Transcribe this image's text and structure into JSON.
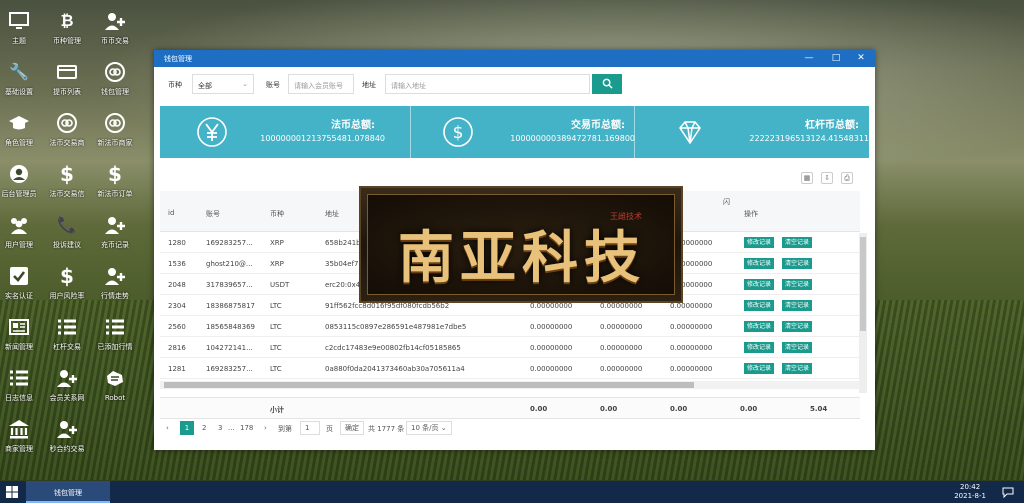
{
  "desktop": {
    "icons": [
      {
        "label": "主题",
        "icon": "monitor-icon"
      },
      {
        "label": "币种管理",
        "icon": "bitcoin-icon"
      },
      {
        "label": "币币交易",
        "icon": "user-plus-icon"
      },
      {
        "label": "基础设置",
        "icon": "wrench-icon"
      },
      {
        "label": "提币列表",
        "icon": "card-icon"
      },
      {
        "label": "钱包管理",
        "icon": "link-icon"
      },
      {
        "label": "角色管理",
        "icon": "graduation-icon"
      },
      {
        "label": "法币交易商",
        "icon": "link-icon"
      },
      {
        "label": "新法币商家",
        "icon": "link-icon"
      },
      {
        "label": "后台管理员",
        "icon": "user-circle-icon"
      },
      {
        "label": "法币交易信",
        "icon": "dollar-icon"
      },
      {
        "label": "新法币订单",
        "icon": "dollar-icon"
      },
      {
        "label": "用户管理",
        "icon": "users-icon"
      },
      {
        "label": "投诉建议",
        "icon": "phone-icon"
      },
      {
        "label": "充币记录",
        "icon": "user-plus-icon"
      },
      {
        "label": "实名认证",
        "icon": "check-icon"
      },
      {
        "label": "用户风险率",
        "icon": "dollar-icon"
      },
      {
        "label": "行情走势",
        "icon": "user-plus-icon"
      },
      {
        "label": "新闻管理",
        "icon": "news-icon"
      },
      {
        "label": "杠杆交易",
        "icon": "list-icon"
      },
      {
        "label": "已添加行情",
        "icon": "list-icon"
      },
      {
        "label": "日志信息",
        "icon": "list-icon"
      },
      {
        "label": "会员关系网",
        "icon": "user-plus-icon"
      },
      {
        "label": "Robot",
        "icon": "robot-icon"
      },
      {
        "label": "商家管理",
        "icon": "bank-icon"
      },
      {
        "label": "秒合约交易",
        "icon": "user-plus-icon"
      }
    ]
  },
  "window": {
    "title": "钱包管理",
    "controls": {
      "minimize": "—",
      "maximize": "□",
      "close": "✕"
    }
  },
  "filters": {
    "currency_label": "币种",
    "currency_value": "全部",
    "account_label": "账号",
    "account_placeholder": "请输入会员账号",
    "address_label": "地址",
    "address_placeholder": "请输入地址"
  },
  "stats": [
    {
      "title": "法币总额:",
      "value": "100000001213755481.078840",
      "icon": "yen-icon"
    },
    {
      "title": "交易币总额:",
      "value": "100000000389472781.169800",
      "icon": "dollar-icon"
    },
    {
      "title": "杠杆币总额:",
      "value": "222223196513124.41548311",
      "icon": "diamond-icon"
    }
  ],
  "table": {
    "headers": [
      "id",
      "账号",
      "币种",
      "地址",
      "闪",
      "操作"
    ],
    "rows": [
      {
        "id": "1280",
        "account": "169283257...",
        "currency": "XRP",
        "address": "658b241b",
        "c1": "",
        "c2": "",
        "c3": "0.00000000"
      },
      {
        "id": "1536",
        "account": "ghost210@...",
        "currency": "XRP",
        "address": "35b04ef7",
        "c1": "",
        "c2": "",
        "c3": "0.00000000"
      },
      {
        "id": "2048",
        "account": "317839657...",
        "currency": "USDT",
        "address": "erc20:0x4",
        "c1": "",
        "c2": "",
        "c3": "0.00000000"
      },
      {
        "id": "2304",
        "account": "18386875817",
        "currency": "LTC",
        "address": "91ff562fcc8d016f95df080fcdb56b2",
        "c1": "0.00000000",
        "c2": "0.00000000",
        "c3": "0.00000000"
      },
      {
        "id": "2560",
        "account": "18565848369",
        "currency": "LTC",
        "address": "0853115c0897e286591e487981e7dbe5",
        "c1": "0.00000000",
        "c2": "0.00000000",
        "c3": "0.00000000"
      },
      {
        "id": "2816",
        "account": "104272141...",
        "currency": "LTC",
        "address": "c2cdc17483e9e00802fb14cf05185865",
        "c1": "0.00000000",
        "c2": "0.00000000",
        "c3": "0.00000000"
      },
      {
        "id": "1281",
        "account": "169283257...",
        "currency": "LTC",
        "address": "0a880f0da2041373460ab30a705611a4",
        "c1": "0.00000000",
        "c2": "0.00000000",
        "c3": "0.00000000"
      }
    ],
    "action_edit": "修改记录",
    "action_clear": "清空记录",
    "totals": {
      "label": "小计",
      "v1": "0.00",
      "v2": "0.00",
      "v3": "0.00",
      "v4": "0.00",
      "v5": "5.04"
    }
  },
  "pager": {
    "prev": "‹",
    "current": "1",
    "p2": "2",
    "p3": "3",
    "ellipsis": "...",
    "last": "178",
    "next": "›",
    "goto_label": "到第",
    "goto_value": "1",
    "page_unit": "页",
    "confirm": "确定",
    "total": "共 1777 条",
    "per_page": "10 条/页"
  },
  "logo": {
    "text": "南亚科技",
    "small": "王雌技术"
  },
  "taskbar": {
    "app": "钱包管理",
    "time": "20:42",
    "date": "2021-8-1"
  },
  "colors": {
    "titlebar": "#1e6fc3",
    "accent": "#1a9b8e",
    "stats": "#45b3c7",
    "taskbar": "#13294a"
  }
}
